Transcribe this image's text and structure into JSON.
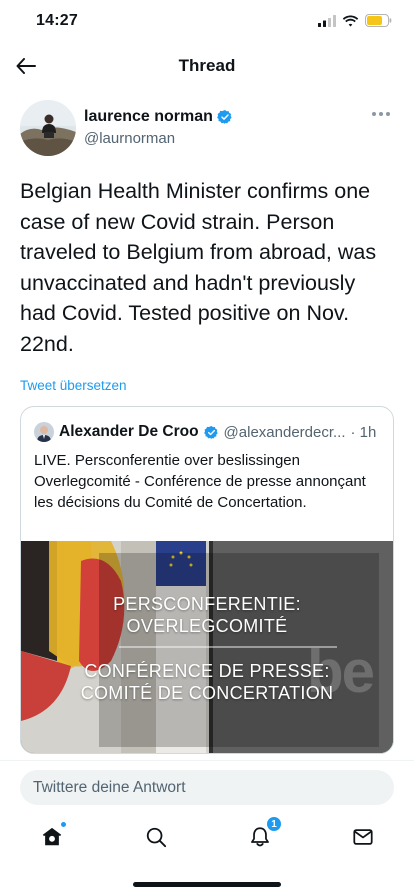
{
  "status_bar": {
    "time": "14:27",
    "icons": [
      "cellular-signal-icon",
      "wifi-icon",
      "battery-icon"
    ],
    "battery_color": "#f5c518"
  },
  "header": {
    "title": "Thread",
    "back_icon": "back-arrow-icon"
  },
  "tweet": {
    "author_name": "laurence norman",
    "author_handle": "@laurnorman",
    "verified": true,
    "text": "Belgian Health Minister confirms one case of new Covid strain. Person traveled to Belgium from abroad, was unvaccinated and hadn't previously had Covid. Tested positive on Nov. 22nd.",
    "translate_label": "Tweet übersetzen"
  },
  "quoted_tweet": {
    "author_name": "Alexander De Croo",
    "author_handle": "@alexanderdecr...",
    "time": "· 1h",
    "verified": true,
    "text": "LIVE. Persconferentie over beslissingen Overlegcomité - Conférence de presse annonçant les décisions du Comité de Concertation.",
    "media": {
      "caption_top_line1": "PERSCONFERENTIE:",
      "caption_top_line2": "OVERLEGCOMITÉ",
      "caption_bottom_line1": "CONFÉRENCE DE PRESSE:",
      "caption_bottom_line2": "COMITÉ DE CONCERTATION",
      "watermark": "be"
    }
  },
  "reply": {
    "placeholder": "Twittere deine Antwort"
  },
  "tabbar": {
    "items": [
      {
        "name": "home",
        "icon": "home-icon",
        "has_dot": true
      },
      {
        "name": "search",
        "icon": "search-icon"
      },
      {
        "name": "notifications",
        "icon": "bell-icon",
        "badge": "1"
      },
      {
        "name": "messages",
        "icon": "mail-icon"
      }
    ]
  },
  "colors": {
    "accent": "#1d9bf0",
    "text": "#0f1419",
    "secondary": "#536471",
    "border": "#cfd9de"
  }
}
